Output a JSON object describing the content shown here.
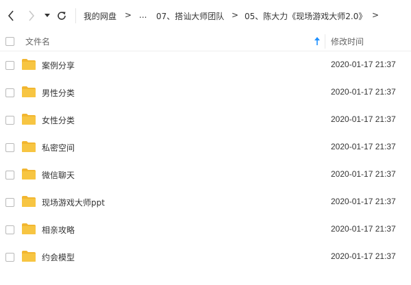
{
  "breadcrumb": {
    "root": "我的网盘",
    "ellipsis": "...",
    "folder1": "07、搭讪大师团队",
    "folder2": "05、陈大力《现场游戏大师2.0》",
    "sep": ">"
  },
  "columns": {
    "name": "文件名",
    "modified": "修改时间"
  },
  "files": [
    {
      "name": "案例分享",
      "modified": "2020-01-17 21:37"
    },
    {
      "name": "男性分类",
      "modified": "2020-01-17 21:37"
    },
    {
      "name": "女性分类",
      "modified": "2020-01-17 21:37"
    },
    {
      "name": "私密空间",
      "modified": "2020-01-17 21:37"
    },
    {
      "name": "微信聊天",
      "modified": "2020-01-17 21:37"
    },
    {
      "name": "现场游戏大师ppt",
      "modified": "2020-01-17 21:37"
    },
    {
      "name": "相亲攻略",
      "modified": "2020-01-17 21:37"
    },
    {
      "name": "约会模型",
      "modified": "2020-01-17 21:37"
    }
  ],
  "colors": {
    "folder": "#f7c542",
    "folder_tab": "#f2b630",
    "sort_arrow": "#1e90ff"
  },
  "icons": {
    "back": "chevron-left-icon",
    "forward": "chevron-right-icon",
    "dropdown": "caret-down-icon",
    "refresh": "refresh-icon",
    "sort": "sort-up-icon",
    "folder": "folder-icon"
  }
}
